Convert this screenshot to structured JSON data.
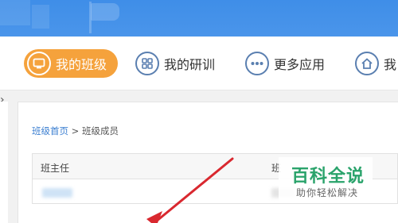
{
  "nav": {
    "items": [
      {
        "label": "我的班级",
        "icon": "monitor-icon",
        "active": true
      },
      {
        "label": "我的研训",
        "icon": "grid-icon",
        "active": false
      },
      {
        "label": "更多应用",
        "icon": "more-dots-icon",
        "active": false
      },
      {
        "label": "我",
        "icon": "home-icon",
        "active": false
      }
    ],
    "active_color": "#f5a23c",
    "icon_ring_color": "#5a7fb0"
  },
  "breadcrumb": {
    "home": "班级首页",
    "separator": " > ",
    "current": "班级成员"
  },
  "table": {
    "headers": [
      "班主任",
      "班"
    ]
  },
  "watermark": {
    "title": "百科全说",
    "subtitle": "助你轻松解决",
    "color": "#2aa36b"
  },
  "banner": {
    "color": "#4a95ea"
  },
  "annotation": {
    "color": "#d9282f"
  }
}
